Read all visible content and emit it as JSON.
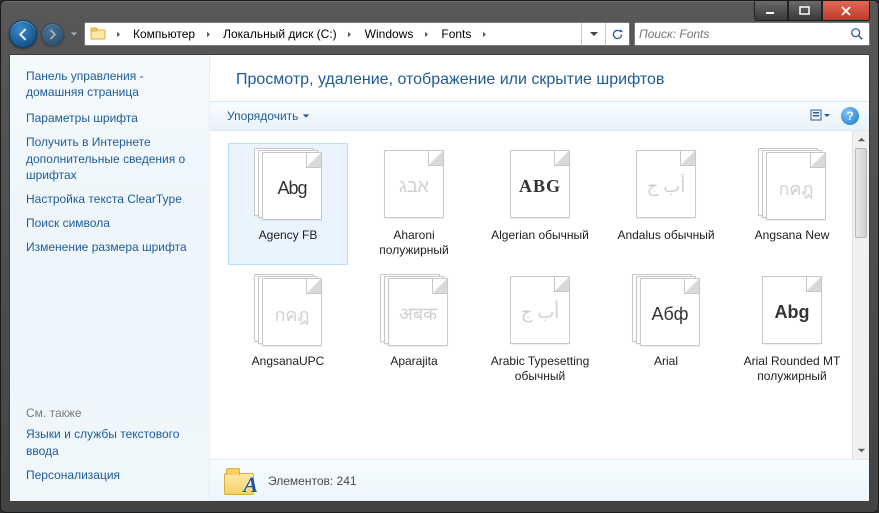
{
  "window": {
    "controls": {
      "min": "minimize",
      "max": "maximize",
      "close": "close"
    }
  },
  "breadcrumbs": [
    {
      "label": "Компьютер"
    },
    {
      "label": "Локальный диск (C:)"
    },
    {
      "label": "Windows"
    },
    {
      "label": "Fonts"
    }
  ],
  "search": {
    "placeholder": "Поиск: Fonts"
  },
  "sidebar": {
    "header": "Панель управления - домашняя страница",
    "links": [
      "Параметры шрифта",
      "Получить в Интернете дополнительные сведения о шрифтах",
      "Настройка текста ClearType",
      "Поиск символа",
      "Изменение размера шрифта"
    ],
    "see_also_label": "См. также",
    "see_also": [
      "Языки и службы текстового ввода",
      "Персонализация"
    ]
  },
  "main": {
    "title": "Просмотр, удаление, отображение или скрытие шрифтов",
    "organize_label": "Упорядочить"
  },
  "fonts": [
    {
      "name": "Agency FB",
      "preview": "Abg",
      "dim": false,
      "stack": true,
      "selected": true,
      "style": "font-family:Arial; font-weight:400; letter-spacing:-1px;"
    },
    {
      "name": "Aharoni полужирный",
      "preview": "אבג",
      "dim": true,
      "stack": false,
      "selected": false,
      "style": "font-family:Arial;"
    },
    {
      "name": "Algerian обычный",
      "preview": "ABG",
      "dim": false,
      "stack": false,
      "selected": false,
      "style": "font-family:'Times New Roman'; font-weight:bold; letter-spacing:1px;"
    },
    {
      "name": "Andalus обычный",
      "preview": "أب ج",
      "dim": true,
      "stack": false,
      "selected": false,
      "style": "font-family:Arial;"
    },
    {
      "name": "Angsana New",
      "preview": "กคฎ",
      "dim": true,
      "stack": true,
      "selected": false,
      "style": "font-family:Arial;"
    },
    {
      "name": "AngsanaUPC",
      "preview": "กคฎ",
      "dim": true,
      "stack": true,
      "selected": false,
      "style": "font-family:Arial;"
    },
    {
      "name": "Aparajita",
      "preview": "अबक",
      "dim": true,
      "stack": true,
      "selected": false,
      "style": "font-family:Arial;"
    },
    {
      "name": "Arabic Typesetting обычный",
      "preview": "أب ج",
      "dim": true,
      "stack": false,
      "selected": false,
      "style": "font-family:Arial;"
    },
    {
      "name": "Arial",
      "preview": "Абф",
      "dim": false,
      "stack": true,
      "selected": false,
      "style": "font-family:Arial; font-weight:400;"
    },
    {
      "name": "Arial Rounded MT полужирный",
      "preview": "Abg",
      "dim": false,
      "stack": false,
      "selected": false,
      "style": "font-family:Arial; font-weight:bold;"
    }
  ],
  "status": {
    "count_label": "Элементов: 241",
    "icon_letter": "A"
  }
}
